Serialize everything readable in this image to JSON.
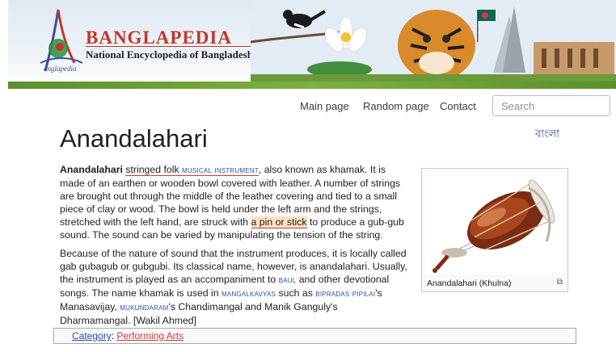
{
  "banner": {
    "brand": "BANGLAPEDIA",
    "tagline": "National Encyclopedia of Bangladesh",
    "logo_small": "anglapedia"
  },
  "nav": {
    "items": [
      "Main page",
      "Random page",
      "Contact"
    ],
    "search_placeholder": "Search"
  },
  "lang_link": "বাংলা",
  "page": {
    "title": "Anandalahari",
    "p1": {
      "term": "Anandalahari",
      "a": "stringed folk ",
      "link_musical": "musical instrument",
      "b": ", also known as khamak. It is made of an earthen or wooden bowl covered with leather. A number of strings are brought out through the middle of the leather covering and tied to a small piece of clay or wood. The bowl is held under the left arm and the strings, stretched with the left hand, are struck with ",
      "hl": "a pin or stick",
      "c": " to produce a gub-gub sound. The sound can be varied by manipulating the tension of the string."
    },
    "p2": {
      "a": "Because of the nature of sound that the instrument produces, it is locally called gab gubagub or gubgubi. Its classical name, however, is anandalahari. Usually, the instrument is played as an accompaniment to ",
      "link_baul": "baul",
      "b": " and other devotional songs. The name khamak is used in ",
      "link_mangal": "mangalkavyas",
      "c": " such as ",
      "link_bipradas": "bipradas pipilai",
      "d": "'s Manasavijay, ",
      "link_mukund": "mukundaram",
      "e": "'s Chandimangal and Manik Ganguly's Dharmamangal. [Wakil Ahmed]"
    },
    "figure_caption": "Anandalahari (Khulna)",
    "category_label": "Category",
    "category_sep": ": ",
    "category_value": "Performing Arts"
  },
  "colors": {
    "link": "#2a4fb4",
    "brand_red": "#c0392b",
    "highlight": "#fde0c4",
    "underline": "#d13b2f"
  },
  "icons": [
    "banglapedia-logo-icon",
    "enlarge-icon"
  ]
}
